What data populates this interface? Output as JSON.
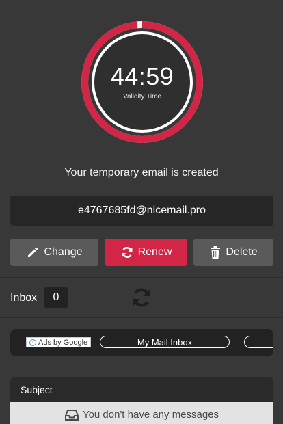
{
  "timer": {
    "value": "44:59",
    "label": "Validity Time",
    "progress": 0.985,
    "ring_color": "#d32647"
  },
  "status": {
    "created_text": "Your temporary email is created"
  },
  "email": {
    "address": "e4767685fd@nicemail.pro"
  },
  "actions": {
    "change_label": "Change",
    "renew_label": "Renew",
    "delete_label": "Delete",
    "change_icon": "pencil-icon",
    "renew_icon": "refresh-icon",
    "delete_icon": "trash-icon"
  },
  "inbox": {
    "label": "Inbox",
    "count": "0",
    "refresh_icon": "refresh-icon"
  },
  "ad": {
    "ads_by_google": "Ads by Google",
    "link_1": "My Mail Inbox",
    "link_2": ""
  },
  "messages": {
    "column_subject": "Subject",
    "empty_text": "You don't have any messages",
    "empty_icon": "inbox-tray-icon"
  },
  "colors": {
    "background": "#383838",
    "accent": "#d32647",
    "button_gray": "#5a5a5a",
    "field_dark": "#262626"
  }
}
